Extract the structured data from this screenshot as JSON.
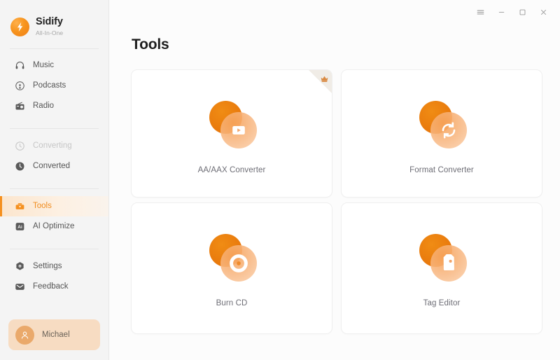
{
  "app": {
    "brand_name": "Sidify",
    "brand_subtitle": "All-In-One",
    "accent_color": "#f5901f",
    "sidebar_bg": "#f4f4f4"
  },
  "titlebar": {
    "menu_label": "☰",
    "minimize_label": "–",
    "maximize_label": "❐",
    "close_label": "×"
  },
  "sidebar": {
    "groups": [
      {
        "items": [
          {
            "label": "Music",
            "icon": "headphones-icon",
            "state": "normal"
          },
          {
            "label": "Podcasts",
            "icon": "podcast-icon",
            "state": "normal"
          },
          {
            "label": "Radio",
            "icon": "radio-icon",
            "state": "normal"
          }
        ]
      },
      {
        "items": [
          {
            "label": "Converting",
            "icon": "converting-icon",
            "state": "disabled"
          },
          {
            "label": "Converted",
            "icon": "clock-icon",
            "state": "normal"
          }
        ]
      },
      {
        "items": [
          {
            "label": "Tools",
            "icon": "toolbox-icon",
            "state": "active"
          },
          {
            "label": "AI Optimize",
            "icon": "ai-badge-icon",
            "state": "normal"
          }
        ]
      },
      {
        "items": [
          {
            "label": "Settings",
            "icon": "gear-icon",
            "state": "normal"
          },
          {
            "label": "Feedback",
            "icon": "message-icon",
            "state": "normal"
          }
        ]
      }
    ],
    "user": {
      "name": "Michael",
      "avatar_icon": "person-icon"
    }
  },
  "main": {
    "page_title": "Tools",
    "cards": [
      {
        "label": "AA/AAX Converter",
        "icon": "video-play-icon",
        "badge": "crown-icon",
        "has_badge": true
      },
      {
        "label": "Format Converter",
        "icon": "refresh-icon",
        "badge": "",
        "has_badge": false
      },
      {
        "label": "Burn CD",
        "icon": "cd-disc-icon",
        "badge": "",
        "has_badge": false
      },
      {
        "label": "Tag Editor",
        "icon": "tag-icon",
        "badge": "",
        "has_badge": false
      }
    ]
  }
}
